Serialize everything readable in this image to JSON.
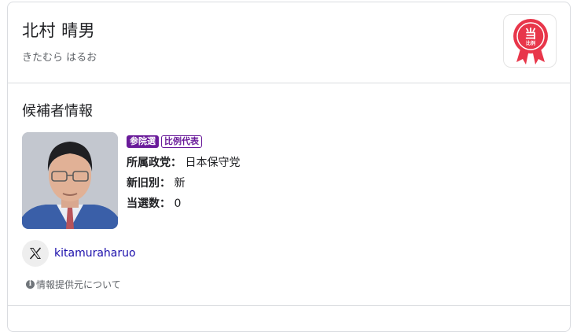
{
  "candidate": {
    "name": "北村 晴男",
    "reading": "きたむら はるお",
    "badge": {
      "main": "当",
      "sub": "比例",
      "color": "#e8364a"
    }
  },
  "section": {
    "title": "候補者情報",
    "tags": [
      "参院選",
      "比例代表"
    ],
    "tag_color": "#6a1b9a",
    "fields": [
      {
        "label": "所属政党：",
        "value": "日本保守党"
      },
      {
        "label": "新旧別：",
        "value": "新"
      },
      {
        "label": "当選数：",
        "value": "0"
      }
    ]
  },
  "social": {
    "icon": "x-logo-icon",
    "handle": "kitamuraharuo",
    "link_color": "#1a0dab"
  },
  "source_link": {
    "icon": "info-icon",
    "label": "情報提供元について"
  }
}
